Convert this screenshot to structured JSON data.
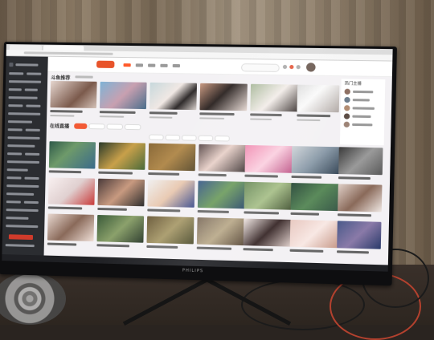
{
  "site": {
    "recommend_heading": "斗鱼推荐",
    "live_heading": "在线直播",
    "hot_streamers_heading": "热门主播"
  },
  "monitor": {
    "brand": "PHILIPS"
  },
  "colors": {
    "accent": "#ff5a2a",
    "sidebar_bg": "#2b2d31",
    "page_bg": "#f3f1f4"
  }
}
